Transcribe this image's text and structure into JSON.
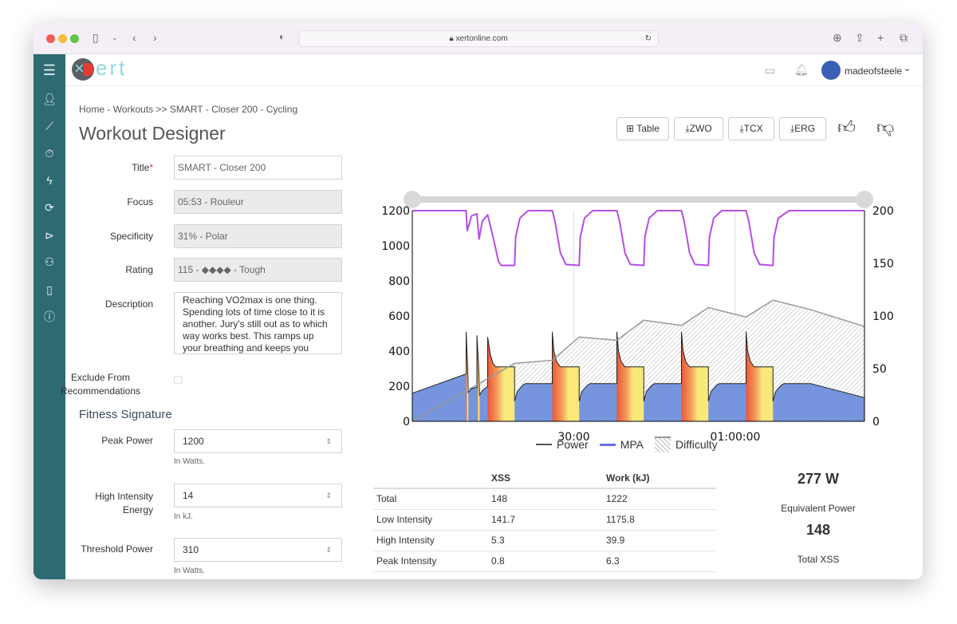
{
  "browser": {
    "url": "xertonline.com"
  },
  "app": {
    "logo_text": "ert",
    "user_name": "madeofsteele"
  },
  "sidebar": {
    "items": [
      "menu-icon",
      "user-icon",
      "chart-icon",
      "timer-icon",
      "bolt-icon",
      "sync-icon",
      "play-icon",
      "group-icon",
      "phone-icon",
      "help-icon"
    ]
  },
  "breadcrumb": {
    "home": "Home",
    "sep1": " - ",
    "workouts": "Workouts",
    "sep2": " >> ",
    "current": "SMART - Closer 200 - Cycling"
  },
  "page_title": "Workout Designer",
  "toolbar": {
    "table": "Table",
    "zwo": "ZWO",
    "tcx": "TCX",
    "erg": "ERG"
  },
  "form": {
    "title_label": "Title",
    "required_mark": "*",
    "title_value": "SMART - Closer 200",
    "focus_label": "Focus",
    "focus_value": "05:53 - Rouleur",
    "specificity_label": "Specificity",
    "specificity_value": "31% - Polar",
    "rating_label": "Rating",
    "rating_value": "115 - ◆◆◆◆ - Tough",
    "description_label": "Description",
    "description_value": "Reaching VO2max is one thing.  Spending lots of time close to it is another.  Jury's still out as to which way works best.  This ramps up your breathing and keeps you",
    "exclude_label_1": "Exclude From",
    "exclude_label_2": "Recommendations",
    "exclude_checked": false
  },
  "fitness": {
    "heading": "Fitness Signature",
    "peak_label": "Peak Power",
    "peak_value": "1200",
    "peak_hint": "In Watts.",
    "hie_label_1": "High Intensity",
    "hie_label_2": "Energy",
    "hie_value": "14",
    "hie_hint": "In kJ.",
    "tp_label": "Threshold Power",
    "tp_value": "310",
    "tp_hint": "In Watts."
  },
  "chart_data": {
    "type": "area",
    "x_unit": "minutes",
    "xlim": [
      0,
      84
    ],
    "x_ticks": [
      {
        "t": 30,
        "label": "30:00"
      },
      {
        "t": 60,
        "label": "01:00:00"
      }
    ],
    "y_left": {
      "lim": [
        0,
        1200
      ],
      "ticks": [
        "0",
        "200",
        "400",
        "600",
        "800",
        "1000",
        "1200"
      ]
    },
    "y_right": {
      "lim": [
        0,
        200
      ],
      "ticks": [
        "0",
        "50",
        "100",
        "150",
        "200"
      ]
    },
    "legend": {
      "position": "bottom",
      "power": "Power",
      "mpa": "MPA",
      "difficulty": "Difficulty"
    },
    "colors": {
      "power_fill": "#6f8fdc",
      "mpa": "#b44ee6",
      "difficulty_line": "#999999",
      "interval_hot": "#e9573a",
      "interval_warm": "#f9e87a"
    },
    "power": [
      [
        0,
        160
      ],
      [
        10,
        270
      ],
      [
        10,
        510
      ],
      [
        10.3,
        300
      ],
      [
        10.4,
        165
      ],
      [
        11,
        185
      ],
      [
        12,
        195
      ],
      [
        12,
        490
      ],
      [
        12.3,
        330
      ],
      [
        12.5,
        150
      ],
      [
        13,
        175
      ],
      [
        14,
        200
      ],
      [
        14,
        480
      ],
      [
        14.5,
        380
      ],
      [
        15,
        330
      ],
      [
        15.5,
        310
      ],
      [
        19,
        310
      ],
      [
        19,
        115
      ],
      [
        19.5,
        170
      ],
      [
        20.5,
        205
      ],
      [
        21,
        215
      ],
      [
        26,
        215
      ],
      [
        26,
        510
      ],
      [
        26.3,
        400
      ],
      [
        26.8,
        340
      ],
      [
        27.5,
        310
      ],
      [
        31,
        310
      ],
      [
        31,
        115
      ],
      [
        31.5,
        170
      ],
      [
        32.5,
        205
      ],
      [
        33,
        215
      ],
      [
        38,
        215
      ],
      [
        38,
        510
      ],
      [
        38.3,
        400
      ],
      [
        38.8,
        340
      ],
      [
        39.5,
        310
      ],
      [
        43,
        310
      ],
      [
        43,
        115
      ],
      [
        43.5,
        170
      ],
      [
        44.5,
        205
      ],
      [
        45,
        215
      ],
      [
        50,
        215
      ],
      [
        50,
        510
      ],
      [
        50.3,
        400
      ],
      [
        50.8,
        340
      ],
      [
        51.5,
        310
      ],
      [
        55,
        310
      ],
      [
        55,
        115
      ],
      [
        55.5,
        170
      ],
      [
        56.5,
        205
      ],
      [
        57,
        215
      ],
      [
        62,
        215
      ],
      [
        62,
        510
      ],
      [
        62.3,
        400
      ],
      [
        62.8,
        340
      ],
      [
        63.5,
        310
      ],
      [
        67,
        310
      ],
      [
        67,
        115
      ],
      [
        67.5,
        170
      ],
      [
        68.5,
        205
      ],
      [
        69,
        215
      ],
      [
        74,
        215
      ],
      [
        84,
        135
      ]
    ],
    "high_intensity_intervals": [
      [
        10,
        10.4
      ],
      [
        12,
        12.5
      ],
      [
        14,
        19
      ],
      [
        26,
        31
      ],
      [
        38,
        43
      ],
      [
        50,
        55
      ],
      [
        62,
        67
      ]
    ],
    "mpa": [
      [
        0,
        200
      ],
      [
        10,
        200
      ],
      [
        10.2,
        181
      ],
      [
        11,
        195
      ],
      [
        12,
        197
      ],
      [
        12.4,
        173
      ],
      [
        13,
        190
      ],
      [
        14,
        196
      ],
      [
        15,
        175
      ],
      [
        16,
        152
      ],
      [
        16.5,
        148
      ],
      [
        19,
        148
      ],
      [
        19.2,
        175
      ],
      [
        20,
        193
      ],
      [
        21.5,
        200
      ],
      [
        26,
        200
      ],
      [
        26.5,
        190
      ],
      [
        27.5,
        160
      ],
      [
        28.5,
        149
      ],
      [
        31,
        148
      ],
      [
        31.2,
        175
      ],
      [
        32,
        193
      ],
      [
        33.5,
        200
      ],
      [
        38,
        200
      ],
      [
        38.5,
        190
      ],
      [
        39.5,
        160
      ],
      [
        40.5,
        149
      ],
      [
        43,
        148
      ],
      [
        43.2,
        175
      ],
      [
        44,
        193
      ],
      [
        45.5,
        200
      ],
      [
        50,
        200
      ],
      [
        50.5,
        190
      ],
      [
        51.5,
        160
      ],
      [
        52.5,
        149
      ],
      [
        55,
        148
      ],
      [
        55.2,
        175
      ],
      [
        56,
        193
      ],
      [
        57.5,
        200
      ],
      [
        62,
        200
      ],
      [
        62.5,
        190
      ],
      [
        63.5,
        160
      ],
      [
        64.5,
        149
      ],
      [
        67,
        148
      ],
      [
        67.2,
        175
      ],
      [
        68,
        193
      ],
      [
        70,
        200
      ],
      [
        84,
        200
      ]
    ],
    "difficulty": [
      [
        0,
        0
      ],
      [
        19,
        55
      ],
      [
        26,
        58
      ],
      [
        31,
        80
      ],
      [
        38,
        77
      ],
      [
        43,
        96
      ],
      [
        50,
        91
      ],
      [
        55,
        108
      ],
      [
        62,
        99
      ],
      [
        67,
        115
      ],
      [
        74,
        106
      ],
      [
        84,
        90
      ]
    ]
  },
  "stats": {
    "headers": [
      "",
      "XSS",
      "Work (kJ)"
    ],
    "rows": [
      [
        "Total",
        "148",
        "1222"
      ],
      [
        "Low Intensity",
        "141.7",
        "1175.8"
      ],
      [
        "High Intensity",
        "5.3",
        "39.9"
      ],
      [
        "Peak Intensity",
        "0.8",
        "6.3"
      ]
    ],
    "equivalent_power": "277 W",
    "equivalent_power_label": "Equivalent Power",
    "total_xss": "148",
    "total_xss_label": "Total XSS"
  }
}
